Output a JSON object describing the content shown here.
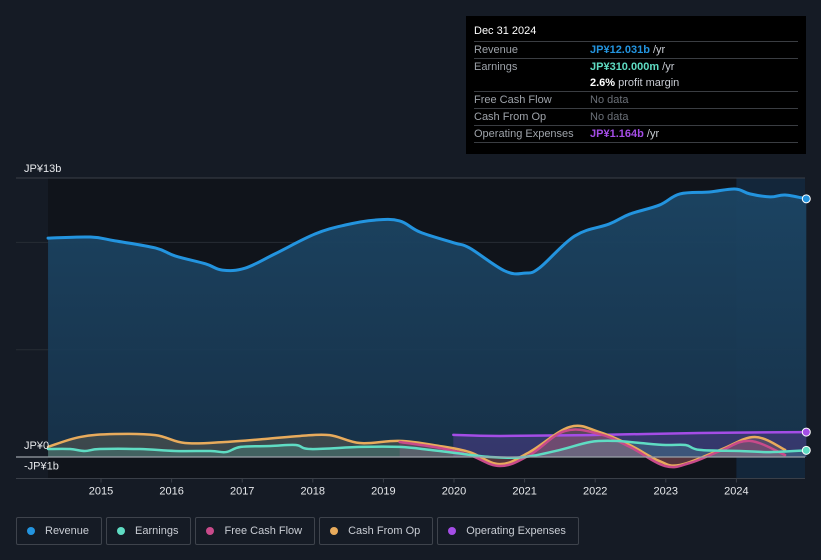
{
  "tooltip": {
    "date": "Dec 31 2024",
    "rows": [
      {
        "label": "Revenue",
        "value": "JP¥12.031b",
        "suffix": " /yr",
        "color": "#2394df"
      },
      {
        "label": "Earnings",
        "value": "JP¥310.000m",
        "suffix": " /yr",
        "color": "#5fdcc3"
      },
      {
        "label": "",
        "value": "2.6%",
        "suffix": " profit margin",
        "color": "#ffffff"
      },
      {
        "label": "Free Cash Flow",
        "value": "No data",
        "suffix": "",
        "color": "#6b7078"
      },
      {
        "label": "Cash From Op",
        "value": "No data",
        "suffix": "",
        "color": "#6b7078"
      },
      {
        "label": "Operating Expenses",
        "value": "JP¥1.164b",
        "suffix": " /yr",
        "color": "#a44de6"
      }
    ]
  },
  "legend": [
    {
      "label": "Revenue",
      "color": "#2394df",
      "icon": "revenue-dot-icon"
    },
    {
      "label": "Earnings",
      "color": "#5fdcc3",
      "icon": "earnings-dot-icon"
    },
    {
      "label": "Free Cash Flow",
      "color": "#c84a8a",
      "icon": "fcf-dot-icon"
    },
    {
      "label": "Cash From Op",
      "color": "#e8ab5c",
      "icon": "cfo-dot-icon"
    },
    {
      "label": "Operating Expenses",
      "color": "#a44de6",
      "icon": "opex-dot-icon"
    }
  ],
  "chart_data": {
    "type": "area",
    "title": "",
    "xlabel": "",
    "ylabel": "",
    "y_unit": "JP¥ billions",
    "ylim": [
      -1,
      13
    ],
    "xlim": [
      2014.25,
      2024.99
    ],
    "y_tick_labels": [
      {
        "value": 13,
        "label": "JP¥13b"
      },
      {
        "value": 0,
        "label": "JP¥0"
      },
      {
        "value": -1,
        "label": "-JP¥1b"
      }
    ],
    "x_tick_labels": [
      "2015",
      "2016",
      "2017",
      "2018",
      "2019",
      "2020",
      "2021",
      "2022",
      "2023",
      "2024"
    ],
    "x_ticks": [
      2015,
      2016,
      2017,
      2018,
      2019,
      2020,
      2021,
      2022,
      2023,
      2024
    ],
    "grid": true,
    "highlight_from": 2024.0,
    "series": [
      {
        "name": "Revenue",
        "color": "#2394df",
        "fill": true,
        "x": [
          2014.25,
          2014.85,
          2015.2,
          2015.77,
          2016.05,
          2016.48,
          2016.72,
          2017.04,
          2017.46,
          2018.03,
          2018.46,
          2018.88,
          2019.23,
          2019.52,
          2020.01,
          2020.22,
          2020.72,
          2021.0,
          2021.21,
          2021.71,
          2022.2,
          2022.49,
          2022.91,
          2023.2,
          2023.62,
          2023.98,
          2024.19,
          2024.48,
          2024.69,
          2024.99
        ],
        "values": [
          10.2,
          10.25,
          10.07,
          9.74,
          9.37,
          9.0,
          8.71,
          8.8,
          9.46,
          10.39,
          10.81,
          11.04,
          11.0,
          10.48,
          9.97,
          9.74,
          8.67,
          8.57,
          8.81,
          10.3,
          10.86,
          11.32,
          11.74,
          12.26,
          12.35,
          12.49,
          12.26,
          12.12,
          12.21,
          12.03
        ]
      },
      {
        "name": "Earnings",
        "color": "#5fdcc3",
        "fill": true,
        "x": [
          2014.25,
          2014.56,
          2014.77,
          2014.98,
          2015.55,
          2016.05,
          2016.55,
          2016.77,
          2016.98,
          2017.4,
          2017.76,
          2017.97,
          2018.68,
          2019.23,
          2019.66,
          2020.01,
          2020.51,
          2021.0,
          2021.5,
          2021.93,
          2022.28,
          2022.64,
          2023.0,
          2023.28,
          2023.48,
          2024.05,
          2024.48,
          2024.99
        ],
        "values": [
          0.37,
          0.37,
          0.28,
          0.37,
          0.37,
          0.28,
          0.28,
          0.23,
          0.47,
          0.51,
          0.56,
          0.37,
          0.47,
          0.47,
          0.33,
          0.19,
          0.0,
          0.0,
          0.33,
          0.7,
          0.75,
          0.65,
          0.56,
          0.56,
          0.33,
          0.28,
          0.23,
          0.31
        ]
      },
      {
        "name": "Free Cash Flow",
        "color": "#c84a8a",
        "fill": true,
        "x": [
          2019.23,
          2019.8,
          2020.22,
          2020.65,
          2021.07,
          2021.57,
          2022.06,
          2022.49,
          2022.99,
          2023.34,
          2023.77,
          2024.19,
          2024.69
        ],
        "values": [
          0.7,
          0.42,
          0.09,
          -0.42,
          0.09,
          1.21,
          1.07,
          0.47,
          -0.42,
          -0.28,
          0.28,
          0.75,
          0.09
        ]
      },
      {
        "name": "Cash From Op",
        "color": "#e8ab5c",
        "fill": true,
        "x": [
          2014.25,
          2014.7,
          2015.2,
          2015.77,
          2016.19,
          2016.76,
          2017.32,
          2017.82,
          2018.24,
          2018.67,
          2019.23,
          2019.8,
          2020.22,
          2020.65,
          2021.07,
          2021.64,
          2022.06,
          2022.49,
          2022.91,
          2023.2,
          2023.77,
          2024.26,
          2024.69
        ],
        "values": [
          0.47,
          0.93,
          1.07,
          1.02,
          0.65,
          0.7,
          0.84,
          0.98,
          1.02,
          0.65,
          0.75,
          0.51,
          0.23,
          -0.33,
          0.23,
          1.4,
          1.16,
          0.56,
          -0.19,
          -0.37,
          0.33,
          0.93,
          0.33
        ]
      },
      {
        "name": "Operating Expenses",
        "color": "#a44de6",
        "fill": true,
        "x": [
          2019.99,
          2020.65,
          2022.06,
          2023.48,
          2024.99
        ],
        "values": [
          1.03,
          0.98,
          1.03,
          1.12,
          1.16
        ]
      }
    ]
  }
}
